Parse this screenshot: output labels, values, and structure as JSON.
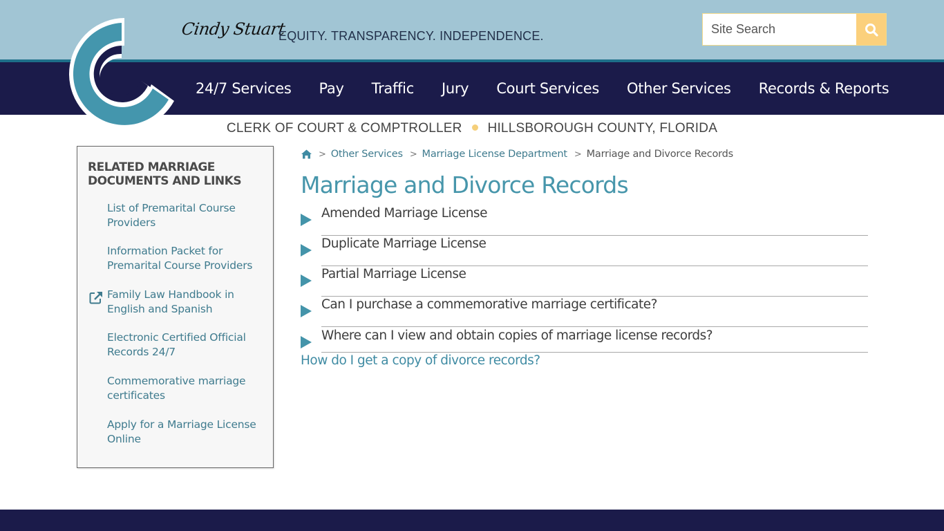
{
  "header": {
    "signature": "Cindy Stuart",
    "tagline": "EQUITY. TRANSPARENCY. INDEPENDENCE.",
    "search": {
      "placeholder": "Site Search",
      "value": "",
      "button_icon": "search-icon"
    },
    "subtitle_left": "CLERK OF COURT & COMPTROLLER",
    "subtitle_right": "HILLSBOROUGH COUNTY, FLORIDA",
    "colors": {
      "top_bar": "#a1c5d4",
      "nav_bar": "#1b1b4a",
      "accent_teal": "#4796ab",
      "accent_yellow": "#fbd07c"
    }
  },
  "nav": {
    "items": [
      {
        "label": "24/7 Services"
      },
      {
        "label": "Pay"
      },
      {
        "label": "Traffic"
      },
      {
        "label": "Jury"
      },
      {
        "label": "Court Services"
      },
      {
        "label": "Other Services"
      },
      {
        "label": "Records & Reports"
      }
    ]
  },
  "sidebar": {
    "title": "RELATED MARRIAGE DOCUMENTS AND LINKS",
    "links": [
      {
        "label": "List of Premarital Course Providers",
        "external": false
      },
      {
        "label": "Information Packet for Premarital Course Providers",
        "external": false
      },
      {
        "label": "Family Law Handbook in English and Spanish",
        "external": true,
        "icon": "external-link-icon"
      },
      {
        "label": "Electronic Certified Official Records 24/7",
        "external": false
      },
      {
        "label": "Commemorative marriage certificates",
        "external": false
      },
      {
        "label": "Apply for a Marriage License Online",
        "external": false
      }
    ]
  },
  "breadcrumb": {
    "home_icon": "home-icon",
    "items": [
      {
        "label": "Other Services"
      },
      {
        "label": "Marriage License Department"
      }
    ],
    "current": "Marriage and Divorce Records"
  },
  "main": {
    "title": "Marriage and Divorce Records",
    "accordion": [
      {
        "label": "Amended Marriage License",
        "expanded": false
      },
      {
        "label": "Duplicate Marriage License",
        "expanded": false
      },
      {
        "label": "Partial Marriage License",
        "expanded": false
      },
      {
        "label": "Can I purchase a commemorative marriage certificate?",
        "expanded": false
      },
      {
        "label": "Where can I view and obtain copies of marriage license records?",
        "expanded": false
      }
    ],
    "divorce_link": "How do I get a copy of divorce records?"
  }
}
